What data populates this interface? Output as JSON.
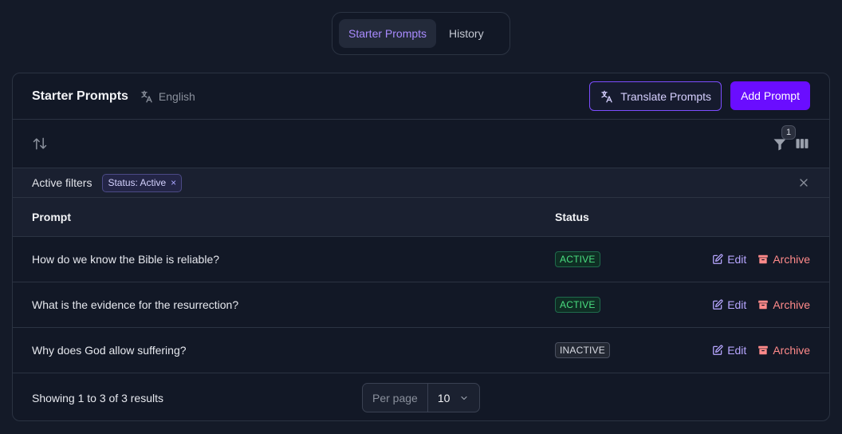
{
  "tabs": [
    {
      "label": "Starter Prompts",
      "active": true
    },
    {
      "label": "History",
      "active": false
    }
  ],
  "card": {
    "title": "Starter Prompts",
    "language": "English",
    "translate_label": "Translate Prompts",
    "add_label": "Add Prompt"
  },
  "toolbar": {
    "filter_count": "1"
  },
  "filters": {
    "label": "Active filters",
    "chip": "Status: Active",
    "chip_remove": "×"
  },
  "table": {
    "headers": {
      "prompt": "Prompt",
      "status": "Status"
    },
    "rows": [
      {
        "prompt": "How do we know the Bible is reliable?",
        "status": "ACTIVE",
        "edit": "Edit",
        "archive": "Archive"
      },
      {
        "prompt": "What is the evidence for the resurrection?",
        "status": "ACTIVE",
        "edit": "Edit",
        "archive": "Archive"
      },
      {
        "prompt": "Why does God allow suffering?",
        "status": "INACTIVE",
        "edit": "Edit",
        "archive": "Archive"
      }
    ]
  },
  "footer": {
    "summary": "Showing 1 to 3 of 3 results",
    "per_page_label": "Per page",
    "per_page_value": "10"
  },
  "colors": {
    "accent": "#6a0dff",
    "active_status": "#4ade80",
    "archive": "#ff8a8a",
    "edit": "#b7a6ff"
  }
}
